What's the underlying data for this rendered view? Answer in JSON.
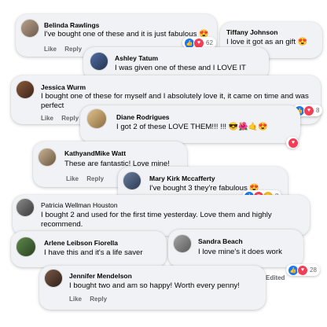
{
  "comments": [
    {
      "name": "Belinda Rawlings",
      "text": "I've bought one of these and it is just fabulous",
      "emoji": "😍",
      "like": "Like",
      "reply": "Reply",
      "count": "62"
    },
    {
      "name": "Tiffany Johnson",
      "text": "I love it got as an gift",
      "emoji": "😍"
    },
    {
      "name": "Ashley Tatum",
      "text": "I was given one of these and I LOVE IT"
    },
    {
      "name": "Jessica Wurm",
      "text": "I bought one of these for myself and I absolutely love it, it came on time and was perfect",
      "like": "Like",
      "reply": "Reply",
      "count": "8"
    },
    {
      "name": "Diane Rodrigues",
      "text": "I got 2 of these LOVE THEM!!! !!!",
      "emoji": "😎🌺🤙😍"
    },
    {
      "name": "KathyandMike Watt",
      "text": "These are fantastic! Love mine!",
      "like": "Like",
      "reply": "Reply"
    },
    {
      "name": "Mary Kirk Mccafferty",
      "text": "I've bought 3 they're fabulous",
      "emoji": "😍",
      "count": "8"
    },
    {
      "name": "Patricia Wellman Houston",
      "text": "I bought 2 and used for the first time yesterday. Love them and highly recommend."
    },
    {
      "name": "Arlene Leibson Fiorella",
      "text": "I have this and it's a life saver"
    },
    {
      "name": "Sandra Beach",
      "text": "I love mine's it does work",
      "edited": "Edited",
      "count": "28"
    },
    {
      "name": "Jennifer Mendelson",
      "text": "I bought two and am so happy! Worth every penny!",
      "like": "Like",
      "reply": "Reply"
    }
  ],
  "icons": {
    "like": "like-icon",
    "love": "love-icon",
    "wow": "wow-icon"
  },
  "colors": {
    "like": "#1877f2",
    "love": "#f33e58",
    "wow": "#f7b125",
    "bubble": "#f0f2f5"
  }
}
